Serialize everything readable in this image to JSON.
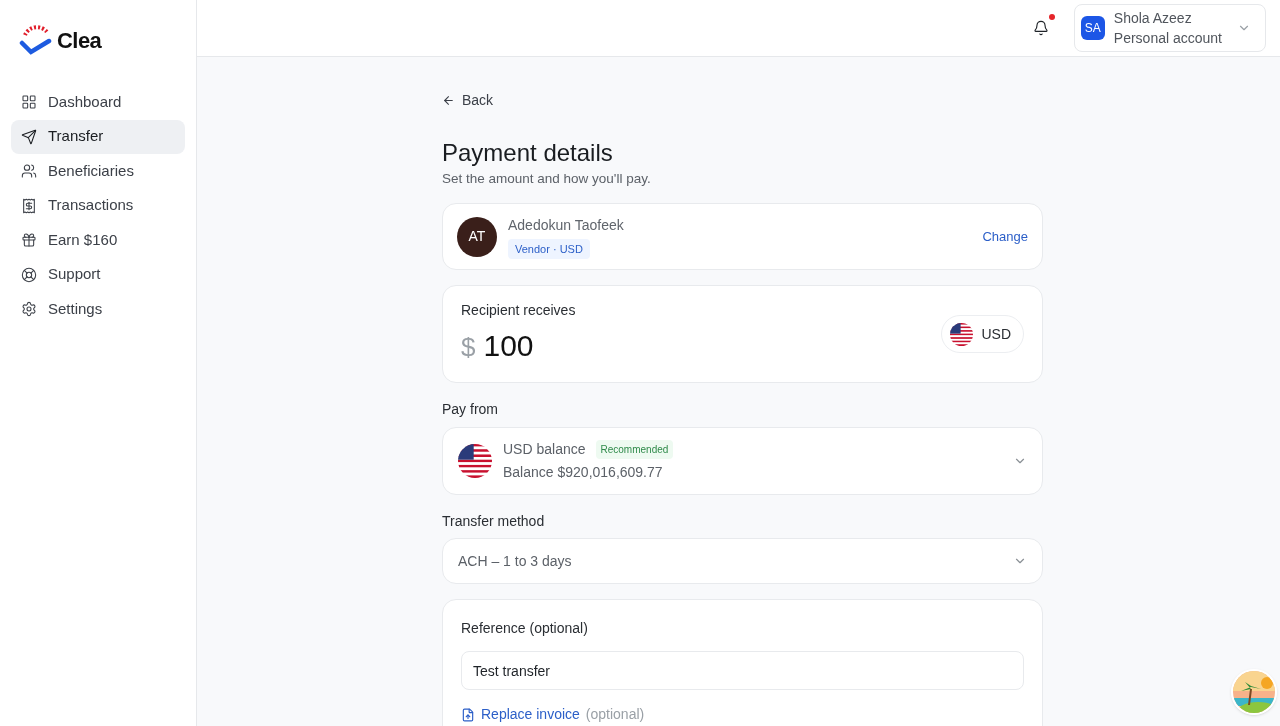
{
  "brand": {
    "name": "Clea"
  },
  "sidebar": {
    "items": [
      {
        "label": "Dashboard",
        "selected": false
      },
      {
        "label": "Transfer",
        "selected": true
      },
      {
        "label": "Beneficiaries",
        "selected": false
      },
      {
        "label": "Transactions",
        "selected": false
      },
      {
        "label": "Earn $160",
        "selected": false
      },
      {
        "label": "Support",
        "selected": false
      },
      {
        "label": "Settings",
        "selected": false
      }
    ]
  },
  "header": {
    "notifications_unread": true,
    "account": {
      "initials": "SA",
      "name": "Shola Azeez",
      "type": "Personal account"
    }
  },
  "back": "Back",
  "title": "Payment details",
  "subtitle": "Set the amount and how you'll pay.",
  "recipient": {
    "initials": "AT",
    "name": "Adedokun Taofeek",
    "tag": "Vendor · USD",
    "action": "Change"
  },
  "amount": {
    "label": "Recipient receives",
    "symbol": "$",
    "value": "100",
    "currency": "USD"
  },
  "pay_from": {
    "label": "Pay from",
    "account": "USD balance",
    "badge": "Recommended",
    "balance": "Balance $920,016,609.77"
  },
  "transfer_method": {
    "label": "Transfer method",
    "value": "ACH – 1 to 3 days"
  },
  "reference": {
    "label": "Reference (optional)",
    "value": "Test transfer",
    "link": "Replace invoice",
    "link_note": "(optional)"
  }
}
